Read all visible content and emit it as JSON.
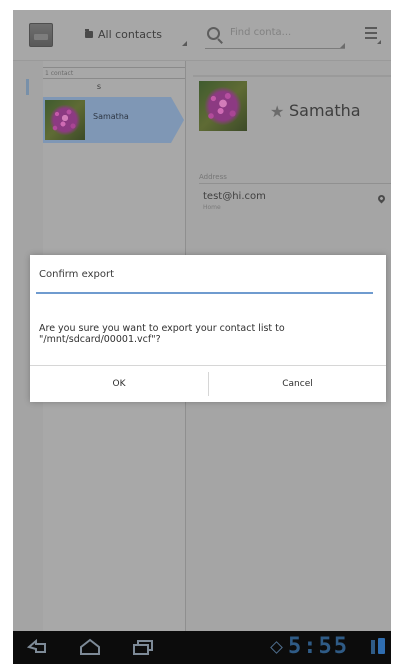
{
  "action_bar": {
    "filter_label": "All contacts",
    "search_placeholder": "Find conta..."
  },
  "list": {
    "header": "1 contact",
    "section_letter": "s",
    "contact_name": "Samatha"
  },
  "detail": {
    "name": "Samatha",
    "address_heading": "Address",
    "email": "test@hi.com",
    "email_type": "Home"
  },
  "dialog": {
    "title": "Confirm export",
    "message": "Are you sure you want to export your contact list to \"/mnt/sdcard/00001.vcf\"?",
    "ok_label": "OK",
    "cancel_label": "Cancel"
  },
  "system_bar": {
    "clock": "5:55"
  },
  "colors": {
    "accent": "#6f9bcf",
    "selection": "#7f97b5",
    "clock": "#2f5b86"
  }
}
